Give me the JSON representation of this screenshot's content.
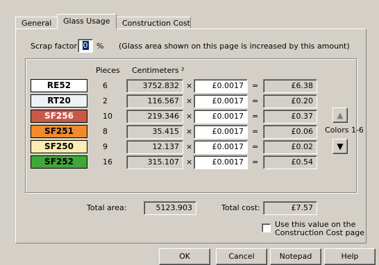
{
  "tabs": [
    "General",
    "Glass Usage",
    "Construction Cost"
  ],
  "scrap": {
    "label": "Scrap factor:",
    "value": "0",
    "unit": "%",
    "note": "(Glass area shown on this page is increased by this amount)"
  },
  "headers": {
    "pieces": "Pieces",
    "centimeters": "Centimeters ²"
  },
  "symbols": {
    "times": "×",
    "equals": "="
  },
  "rows": [
    {
      "name": "RE52",
      "pieces": "6",
      "area": "3752.832",
      "price": "£0.0017",
      "cost": "£6.38",
      "color": "#ffffff",
      "text_color": "#000000"
    },
    {
      "name": "RT20",
      "pieces": "2",
      "area": "116.567",
      "price": "£0.0017",
      "cost": "£0.20",
      "color": "#eef2f5",
      "text_color": "#000000"
    },
    {
      "name": "SF256",
      "pieces": "10",
      "area": "219.346",
      "price": "£0.0017",
      "cost": "£0.37",
      "color": "#c85a48",
      "text_color": "#ffffff"
    },
    {
      "name": "SF251",
      "pieces": "8",
      "area": "35.415",
      "price": "£0.0017",
      "cost": "£0.06",
      "color": "#f08a2a",
      "text_color": "#000000"
    },
    {
      "name": "SF250",
      "pieces": "9",
      "area": "12.137",
      "price": "£0.0017",
      "cost": "£0.02",
      "color": "#fbedb2",
      "text_color": "#000000"
    },
    {
      "name": "SF252",
      "pieces": "16",
      "area": "315.107",
      "price": "£0.0017",
      "cost": "£0.54",
      "color": "#3fa83a",
      "text_color": "#000000"
    }
  ],
  "colors": {
    "label": "Colors 1-6"
  },
  "totals": {
    "area_label": "Total area:",
    "area_value": "5123.903",
    "cost_label": "Total cost:",
    "cost_value": "£7.57"
  },
  "checkbox": {
    "line1": "Use this value on the",
    "line2": "Construction Cost page",
    "checked": false
  },
  "buttons": {
    "ok": "OK",
    "cancel": "Cancel",
    "notepad": "Notepad",
    "help": "Help"
  }
}
